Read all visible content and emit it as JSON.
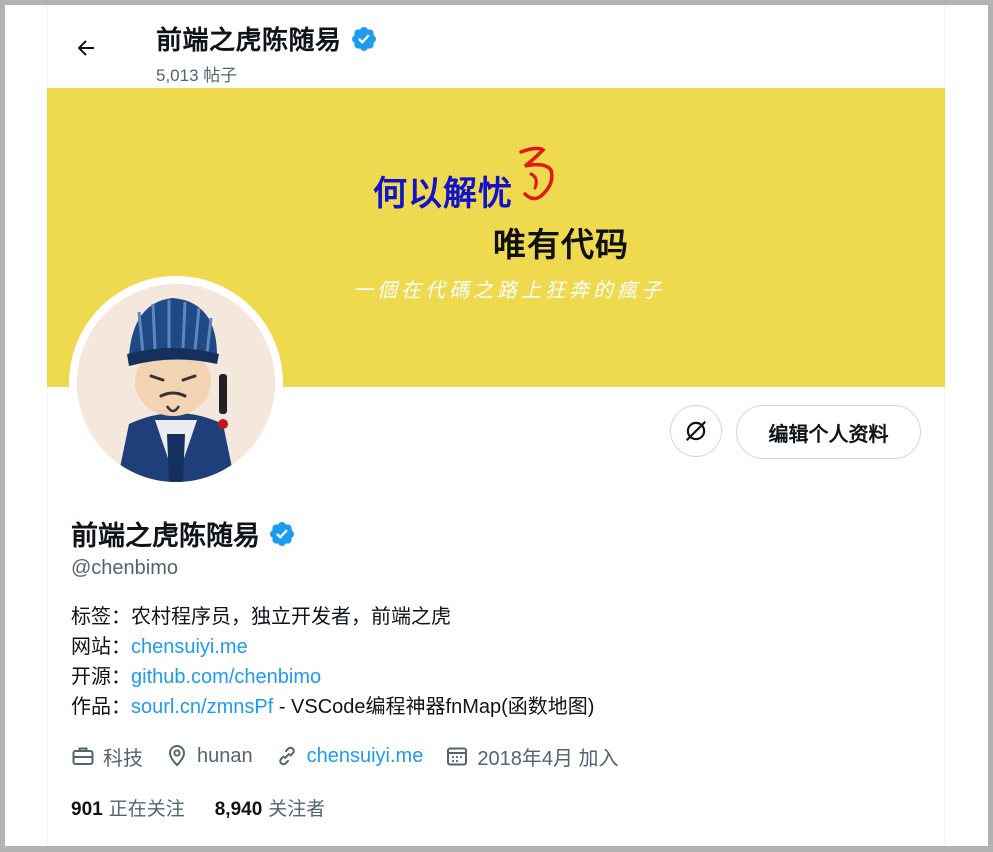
{
  "header": {
    "back_icon": "arrow-left-icon",
    "display_name": "前端之虎陈随易",
    "post_count": "5,013 帖子"
  },
  "banner": {
    "line1": "何以解忧",
    "line2": "唯有代码",
    "line3": "一個在代碼之路上狂奔的瘋子",
    "bg_color": "#efd94f"
  },
  "actions": {
    "icon_button_icon": "strikethrough-circle-icon",
    "edit_label": "编辑个人资料"
  },
  "profile": {
    "display_name": "前端之虎陈随易",
    "handle": "@chenbimo",
    "verified_color": "#1d9bf0",
    "bio": [
      {
        "prefix": "标签：",
        "text": "农村程序员，独立开发者，前端之虎",
        "link": "",
        "suffix": ""
      },
      {
        "prefix": "网站：",
        "text": "",
        "link": "chensuiyi.me",
        "suffix": ""
      },
      {
        "prefix": "开源：",
        "text": "",
        "link": "github.com/chenbimo",
        "suffix": ""
      },
      {
        "prefix": "作品：",
        "text": "",
        "link": "sourl.cn/zmnsPf",
        "suffix": " - VSCode编程神器fnMap(函数地图)"
      }
    ],
    "meta": {
      "category_icon": "briefcase-icon",
      "category": "科技",
      "location_icon": "location-pin-icon",
      "location": "hunan",
      "website_icon": "link-icon",
      "website": "chensuiyi.me",
      "joined_icon": "calendar-icon",
      "joined": "2018年4月 加入"
    },
    "following_count": "901",
    "following_label": "正在关注",
    "followers_count": "8,940",
    "followers_label": "关注者"
  }
}
